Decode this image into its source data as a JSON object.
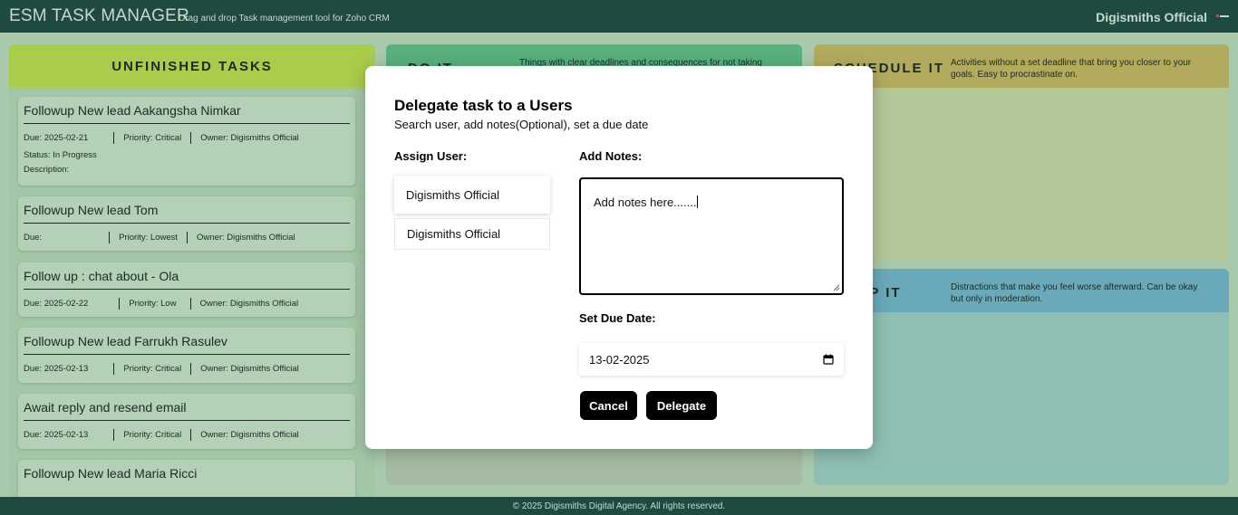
{
  "header": {
    "title": "ESM TASK MANAGER",
    "subtitle": "Drag and drop Task management tool for Zoho CRM",
    "user": "Digismiths Official"
  },
  "columns": {
    "unfinished": {
      "title": "UNFINISHED TASKS"
    },
    "do_it": {
      "title": "DO IT",
      "description": "Things with clear deadlines and consequences for not taking"
    },
    "schedule_it": {
      "title": "SCHEDULE IT",
      "description": "Activities without a set deadline that bring you closer to your goals. Easy to procrastinate on."
    },
    "drop_it": {
      "title": "DROP IT",
      "description": "Distractions that make you feel worse afterward. Can be okay but only in moderation."
    }
  },
  "tasks": [
    {
      "title": "Followup New lead Aakangsha Nimkar",
      "due": "Due: 2025-02-21",
      "priority": "Priority: Critical",
      "owner": "Owner: Digismiths Official",
      "status": "Status: In Progress",
      "description": "Description:"
    },
    {
      "title": "Followup New lead Tom",
      "due": "Due:",
      "priority": "Priority: Lowest",
      "owner": "Owner: Digismiths Official"
    },
    {
      "title": "Follow up : chat about - Ola",
      "due": "Due: 2025-02-22",
      "priority": "Priority: Low",
      "owner": "Owner: Digismiths Official"
    },
    {
      "title": "Followup New lead Farrukh Rasulev",
      "due": "Due: 2025-02-13",
      "priority": "Priority: Critical",
      "owner": "Owner: Digismiths Official"
    },
    {
      "title": "Await reply and resend email",
      "due": "Due: 2025-02-13",
      "priority": "Priority: Critical",
      "owner": "Owner: Digismiths Official"
    },
    {
      "title": "Followup New lead Maria Ricci"
    }
  ],
  "modal": {
    "title": "Delegate task to a Users",
    "subtitle": "Search user, add notes(Optional), set a due date",
    "assign_label": "Assign User:",
    "users": [
      "Digismiths Official",
      "Digismiths Official"
    ],
    "notes_label": "Add Notes:",
    "notes_value": "Add notes here.......",
    "due_label": "Set Due Date:",
    "due_value": "13-02-2025",
    "cancel_label": "Cancel",
    "delegate_label": "Delegate"
  },
  "footer": {
    "text": "© 2025 Digismiths Digital Agency. All rights reserved."
  },
  "colors": {
    "header_bg": "#1f4a40",
    "unfinished_head": "#a9cc4b",
    "do_it_head": "#58b07e",
    "schedule_head": "#b2ab5e",
    "drop_head": "#6aa9b9",
    "button": "#000000"
  }
}
